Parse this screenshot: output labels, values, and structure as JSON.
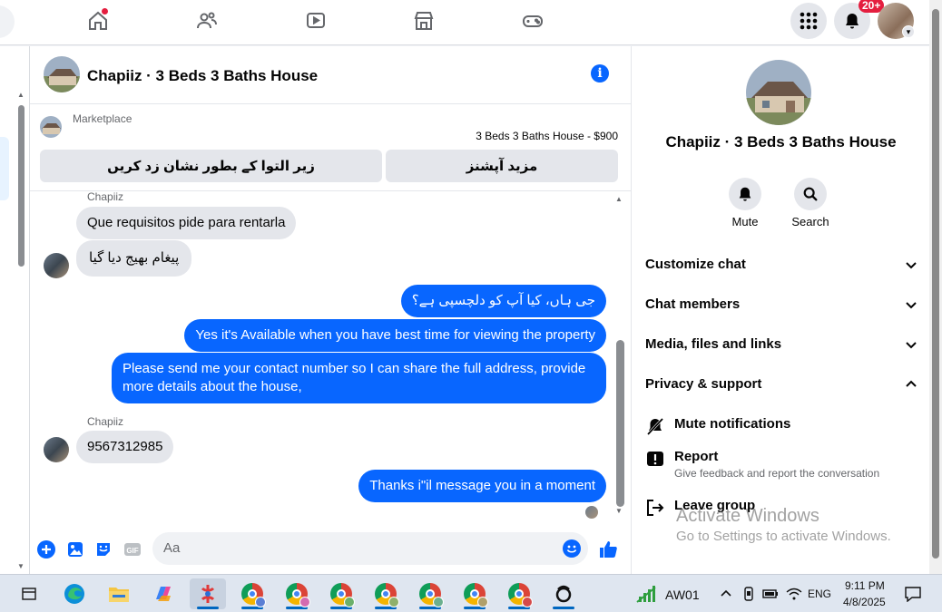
{
  "nav": {
    "items": [
      "home-icon",
      "friends-icon",
      "watch-icon",
      "marketplace-icon",
      "gaming-icon"
    ],
    "notification_badge": "20+"
  },
  "chat": {
    "title": "Chapiiz · 3 Beds 3 Baths House",
    "marketplace": {
      "label": "Marketplace",
      "listing": "3 Beds 3 Baths House - $900",
      "button_left": "زیر التوا کے بطور نشان زد کریں",
      "button_right": "مزید آپشنز"
    },
    "messages": [
      {
        "type": "in",
        "sender": "Chapiiz",
        "text": "Que requisitos pide para rentarla"
      },
      {
        "type": "in",
        "text": "پیغام بھیج دیا گیا"
      },
      {
        "type": "out",
        "text": "جی ہاں، کیا آپ کو دلچسپی ہے؟"
      },
      {
        "type": "out",
        "text": "Yes it's Available when you have best time for viewing the property"
      },
      {
        "type": "out",
        "text": "Please send me your contact number so I can share the full address, provide more details about the house,"
      },
      {
        "type": "in",
        "sender": "Chapiiz",
        "text": "9567312985"
      },
      {
        "type": "out",
        "text": "Thanks i\"il message you in a moment"
      }
    ],
    "composer_placeholder": "Aa"
  },
  "details": {
    "title": "Chapiiz · 3 Beds 3 Baths House",
    "actions": [
      {
        "label": "Mute"
      },
      {
        "label": "Search"
      }
    ],
    "sections": [
      "Customize chat",
      "Chat members",
      "Media, files and links",
      "Privacy & support"
    ],
    "privacy_items": [
      {
        "title": "Mute notifications"
      },
      {
        "title": "Report",
        "subtitle": "Give feedback and report the conversation"
      },
      {
        "title": "Leave group"
      }
    ]
  },
  "watermark": {
    "line1": "Activate Windows",
    "line2": "Go to Settings to activate Windows."
  },
  "taskbar": {
    "network_label": "AW01",
    "lang": "ENG",
    "time": "9:11 PM",
    "date": "4/8/2025"
  },
  "colors": {
    "accent": "#0866ff",
    "bubble_in": "#e4e6eb"
  }
}
